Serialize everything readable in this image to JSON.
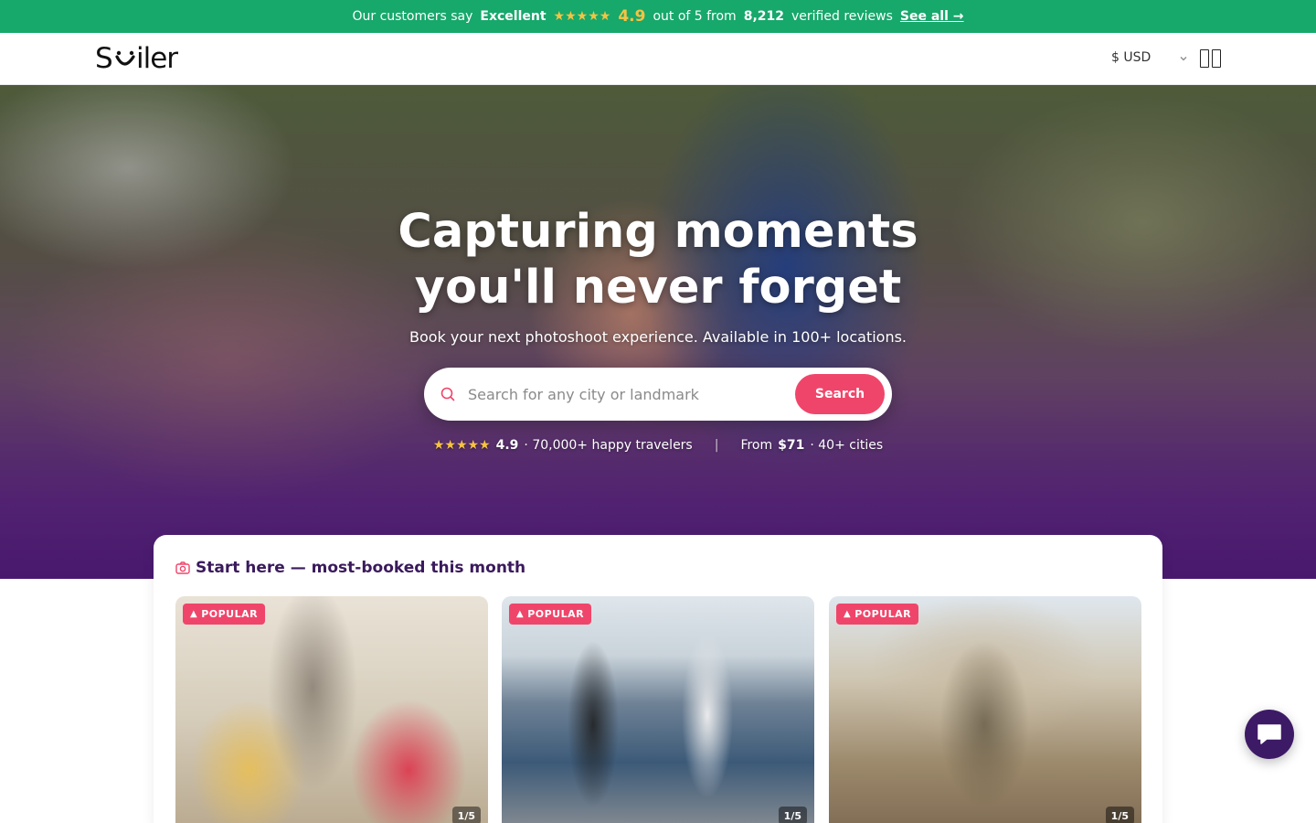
{
  "review_bar": {
    "intro": "Our customers say",
    "rating_word": "Excellent",
    "stars": "★★★★★",
    "score": "4.9",
    "out_of": "out of 5 from",
    "count": "8,212",
    "verified": "verified reviews",
    "see_all": "See all →"
  },
  "header": {
    "logo": "Smiler",
    "currency": "$ USD"
  },
  "hero": {
    "title_line1": "Capturing moments",
    "title_line2": "you'll never forget",
    "subtitle": "Book your next photoshoot experience. Available in 100+ locations.",
    "search": {
      "placeholder": "Search for any city or landmark",
      "button": "Search"
    },
    "stats": {
      "stars": "★★★★★",
      "rating": "4.9",
      "travelers": "· 70,000+ happy travelers",
      "divider": "|",
      "from": "From",
      "price": "$71",
      "cities": "· 40+ cities"
    }
  },
  "popular": {
    "heading": "Start here — most-booked this month",
    "cards": [
      {
        "badge": "POPULAR",
        "counter": "1/5"
      },
      {
        "badge": "POPULAR",
        "counter": "1/5"
      },
      {
        "badge": "POPULAR",
        "counter": "1/5"
      }
    ]
  },
  "colors": {
    "review_bar_bg": "#17a86b",
    "accent": "#f0456a",
    "heading_purple": "#3a1a5c",
    "chat_bg": "#3d1a66",
    "star_yellow": "#f6c343"
  },
  "icons": [
    "search-icon",
    "chevron-down-icon",
    "menu-icon",
    "camera-icon",
    "flame-icon",
    "chat-icon"
  ]
}
